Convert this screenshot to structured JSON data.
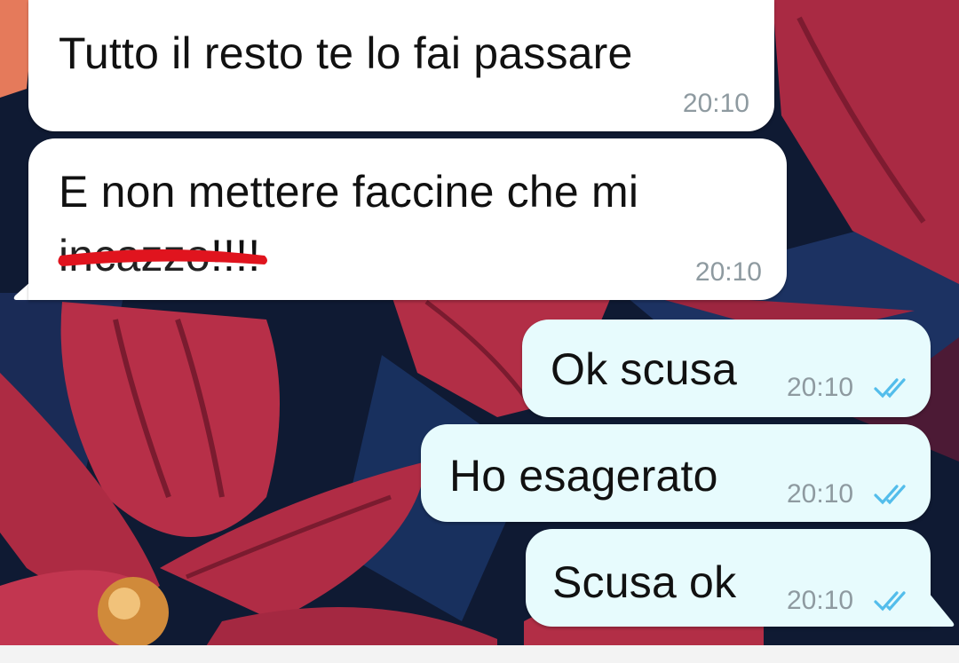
{
  "chat": {
    "messages": [
      {
        "id": "m1",
        "direction": "incoming",
        "text_lines": [
          "Tutto il resto te lo fai passare"
        ],
        "time": "20:10",
        "ticks": false
      },
      {
        "id": "m2",
        "direction": "incoming",
        "text_lines": [
          "E non mettere faccine che mi",
          "incazzo!!!!"
        ],
        "censored_word": "incazzo",
        "time": "20:10",
        "ticks": false
      },
      {
        "id": "m3",
        "direction": "outgoing",
        "text_lines": [
          "Ok scusa"
        ],
        "time": "20:10",
        "ticks": true
      },
      {
        "id": "m4",
        "direction": "outgoing",
        "text_lines": [
          "Ho esagerato"
        ],
        "time": "20:10",
        "ticks": true
      },
      {
        "id": "m5",
        "direction": "outgoing",
        "text_lines": [
          "Scusa ok"
        ],
        "time": "20:10",
        "ticks": true
      }
    ]
  },
  "colors": {
    "incoming_bubble": "#ffffff",
    "outgoing_bubble": "#e7fbfd",
    "read_ticks": "#53bdeb",
    "censor_mark": "#e0141e",
    "wallpaper_dark": "#0f1a33",
    "flower_petal": "#b42d45"
  },
  "icons": {
    "read_receipt": "double-check-icon",
    "wallpaper": "red-flower-wallpaper"
  }
}
